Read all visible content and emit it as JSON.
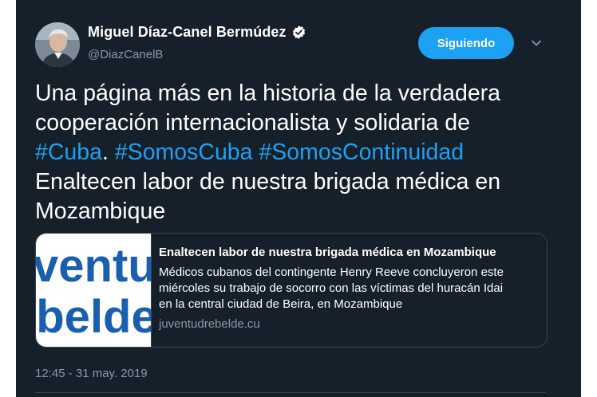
{
  "author": {
    "name": "Miguel Díaz-Canel Bermúdez",
    "handle": "@DiazCanelB",
    "verified": true
  },
  "follow_button": {
    "label": "Siguiendo"
  },
  "tweet": {
    "lines": [
      [
        {
          "text": "Una página más en la historia de la verdadera",
          "hashtag": false
        }
      ],
      [
        {
          "text": "cooperación internacionalista y solidaria de",
          "hashtag": false
        }
      ],
      [
        {
          "text": "#Cuba",
          "hashtag": true
        },
        {
          "text": ". ",
          "hashtag": false
        },
        {
          "text": "#SomosCuba",
          "hashtag": true
        },
        {
          "text": " ",
          "hashtag": false
        },
        {
          "text": "#SomosContinuidad",
          "hashtag": true
        }
      ],
      [
        {
          "text": "Enaltecen labor de nuestra brigada médica en",
          "hashtag": false
        }
      ],
      [
        {
          "text": "Mozambique",
          "hashtag": false
        }
      ]
    ]
  },
  "card": {
    "thumbnail_words": [
      "ventu",
      "ebelde"
    ],
    "title": "Enaltecen labor de nuestra brigada médica en Mozambique",
    "description_lines": [
      "Médicos cubanos del contingente Henry Reeve concluyeron este",
      "miércoles su trabajo de socorro con las víctimas del huracán Idai",
      "en la central ciudad de Beira, en Mozambique"
    ],
    "domain": "juventudrebelde.cu"
  },
  "timestamp": "12:45 - 31 may. 2019",
  "colors": {
    "background": "#15202b",
    "accent": "#1da1f2",
    "secondary_text": "#8899a6",
    "border": "#38444d"
  },
  "icons": {
    "verified": "verified-badge-icon",
    "menu": "chevron-down-icon"
  }
}
